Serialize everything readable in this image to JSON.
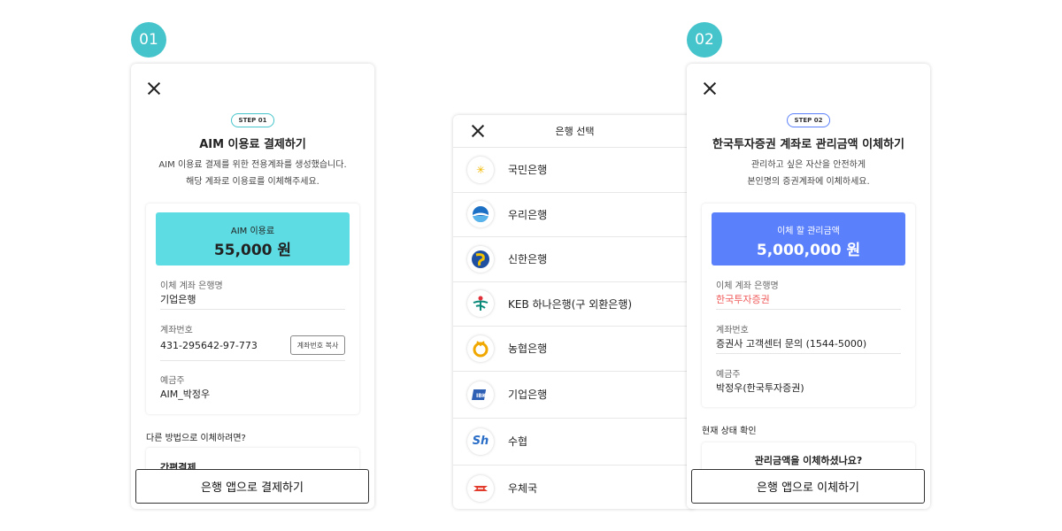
{
  "step1": {
    "badge": "01",
    "pill": "STEP 01",
    "title": "AIM 이용료 결제하기",
    "desc_line1": "AIM 이용료 결제를 위한 전용계좌를 생성했습니다.",
    "desc_line2": "해당 계좌로 이용료를 이체해주세요.",
    "amount_label": "AIM 이용료",
    "amount_value": "55,000 원",
    "fields": [
      {
        "label": "이체 계좌 은행명",
        "value": "기업은행"
      },
      {
        "label": "계좌번호",
        "value": "431-295642-97-773"
      },
      {
        "label": "예금주",
        "value": "AIM_박정우"
      }
    ],
    "copy_button": "계좌번호 복사",
    "other_method_label": "다른 방법으로 이체하려면?",
    "other_method_item": "간편결제",
    "bottom_button": "은행 앱으로 결제하기",
    "accent": "#5ddde3"
  },
  "bank_select": {
    "title": "은행 선택",
    "banks": [
      {
        "name": "국민은행",
        "icon": "kb-star-icon",
        "glyph": "✳",
        "color": "#f2b800"
      },
      {
        "name": "우리은행",
        "icon": "woori-icon",
        "glyph": "◓",
        "color": "#1b6fc4"
      },
      {
        "name": "신한은행",
        "icon": "shinhan-icon",
        "glyph": "S",
        "color": "#1f4fa0"
      },
      {
        "name": "KEB 하나은행(구 외환은행)",
        "icon": "hana-icon",
        "glyph": "⚘",
        "color": "#0b8a7a"
      },
      {
        "name": "농협은행",
        "icon": "nh-icon",
        "glyph": "⚲",
        "color": "#f0a800"
      },
      {
        "name": "기업은행",
        "icon": "ibk-icon",
        "glyph": "◪",
        "color": "#2d5fb5"
      },
      {
        "name": "수협",
        "icon": "suhyup-icon",
        "glyph": "Sh",
        "color": "#2a6ec8"
      },
      {
        "name": "우체국",
        "icon": "post-icon",
        "glyph": "✉",
        "color": "#e23a2a"
      }
    ]
  },
  "step2": {
    "badge": "02",
    "pill": "STEP 02",
    "title": "한국투자증권 계좌로 관리금액 이체하기",
    "desc_line1": "관리하고 싶은 자산을 안전하게",
    "desc_line2": "본인명의 증권계좌에 이체하세요.",
    "amount_label": "이체 할 관리금액",
    "amount_value": "5,000,000 원",
    "fields": [
      {
        "label": "이체 계좌 은행명",
        "value": "한국투자증권"
      },
      {
        "label": "계좌번호",
        "value": "증권사 고객센터 문의 (1544-5000)"
      },
      {
        "label": "예금주",
        "value": "박정우(한국투자증권)"
      }
    ],
    "status_label": "현재 상태 확인",
    "status_question": "관리금액을 이체하셨나요?",
    "bottom_button": "은행 앱으로 이체하기",
    "accent": "#5b80fb",
    "highlight": "#f05a5a"
  }
}
